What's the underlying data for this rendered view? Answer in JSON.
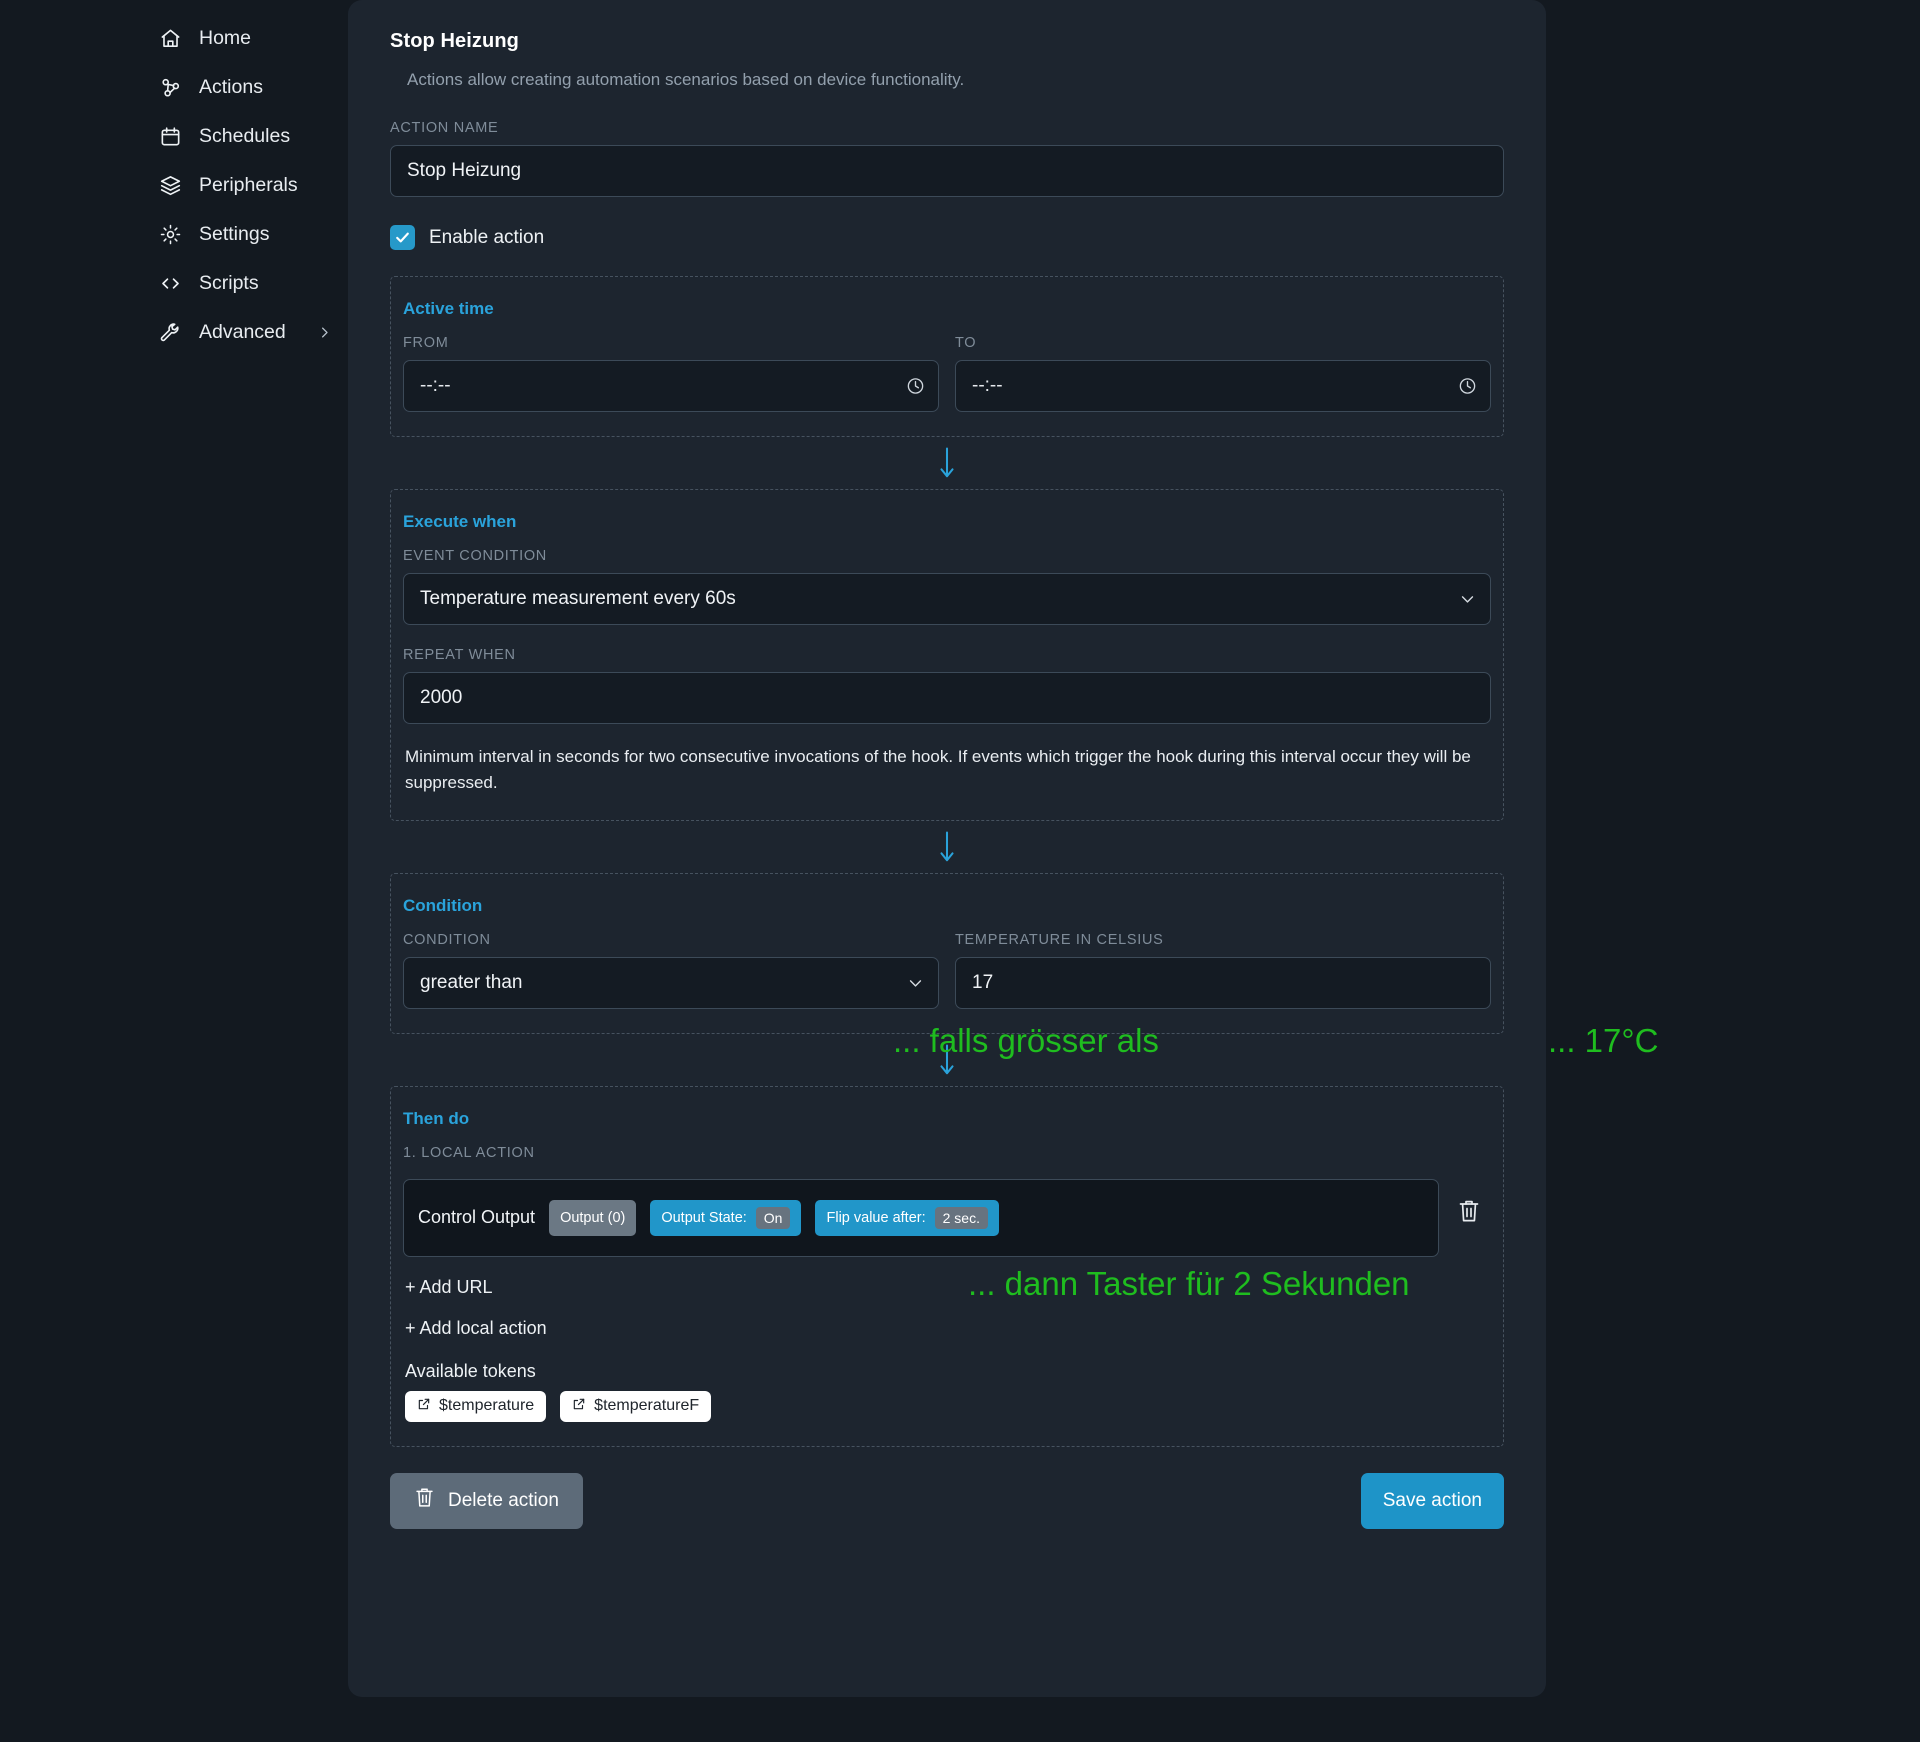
{
  "sidebar": {
    "items": [
      {
        "label": "Home",
        "icon": "home-icon",
        "chevron": false
      },
      {
        "label": "Actions",
        "icon": "actions-icon",
        "chevron": false
      },
      {
        "label": "Schedules",
        "icon": "calendar-icon",
        "chevron": false
      },
      {
        "label": "Peripherals",
        "icon": "layers-icon",
        "chevron": false
      },
      {
        "label": "Settings",
        "icon": "gear-icon",
        "chevron": false
      },
      {
        "label": "Scripts",
        "icon": "code-icon",
        "chevron": false
      },
      {
        "label": "Advanced",
        "icon": "wrench-icon",
        "chevron": true
      }
    ]
  },
  "panel": {
    "title": "Stop Heizung",
    "subtitle": "Actions allow creating automation scenarios based on device functionality.",
    "action_name_label": "ACTION NAME",
    "action_name_value": "Stop Heizung",
    "enable_action_label": "Enable action",
    "enable_action_checked": true
  },
  "active_time": {
    "title": "Active time",
    "from_label": "FROM",
    "from_value": "--:--",
    "to_label": "TO",
    "to_value": "--:--",
    "clock_icon": "clock-icon"
  },
  "execute_when": {
    "title": "Execute when",
    "event_condition_label": "EVENT CONDITION",
    "event_condition_value": "Temperature measurement every 60s",
    "repeat_when_label": "REPEAT WHEN",
    "repeat_when_value": "2000",
    "help_text": "Minimum interval in seconds for two consecutive invocations of the hook. If events which trigger the hook during this interval occur they will be suppressed."
  },
  "condition": {
    "title": "Condition",
    "condition_label": "CONDITION",
    "condition_value": "greater than",
    "temperature_label": "TEMPERATURE IN CELSIUS",
    "temperature_value": "17"
  },
  "then_do": {
    "title": "Then do",
    "local_action_label": "1. LOCAL ACTION",
    "action": {
      "name": "Control Output",
      "output_chip": "Output (0)",
      "state_chip_label": "Output State:",
      "state_chip_value": "On",
      "flip_chip_label": "Flip value after:",
      "flip_chip_value": "2 sec."
    },
    "add_url_label": "+ Add URL",
    "add_local_action_label": "+ Add local action",
    "tokens_label": "Available tokens",
    "tokens": [
      "$temperature",
      "$temperatureF"
    ]
  },
  "footer": {
    "delete_label": "Delete action",
    "save_label": "Save action"
  },
  "annotations": [
    {
      "text": "... falls grösser als"
    },
    {
      "text": "... 17°C"
    },
    {
      "text": "... dann Taster für 2 Sekunden"
    }
  ],
  "colors": {
    "accent": "#2aa3db",
    "annotation_green": "#1fbd1f",
    "page_bg": "#131920",
    "panel_bg": "#1d252f",
    "input_bg": "#141b23",
    "chip_blue": "#2196c9",
    "chip_grey": "#6b7884"
  }
}
